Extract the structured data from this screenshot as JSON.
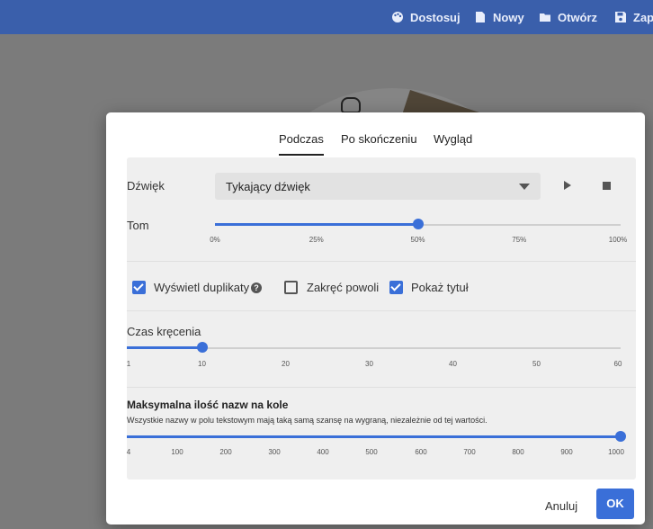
{
  "topbar": {
    "items": [
      {
        "label": "Dostosuj",
        "icon": "palette-icon"
      },
      {
        "label": "Nowy",
        "icon": "file-icon"
      },
      {
        "label": "Otwórz",
        "icon": "folder-icon"
      },
      {
        "label": "Zapi",
        "icon": "save-icon"
      }
    ]
  },
  "dialog": {
    "tabs": [
      {
        "label": "Podczas",
        "active": true
      },
      {
        "label": "Po skończeniu",
        "active": false
      },
      {
        "label": "Wygląd",
        "active": false
      }
    ],
    "sound": {
      "label": "Dźwięk",
      "value": "Tykający dźwięk"
    },
    "volume": {
      "label": "Tom",
      "value_percent": 50,
      "ticks": [
        "0%",
        "25%",
        "50%",
        "75%",
        "100%"
      ]
    },
    "checkboxes": [
      {
        "label": "Wyświetl duplikaty",
        "checked": true,
        "help": "?"
      },
      {
        "label": "Zakręć powoli",
        "checked": false
      },
      {
        "label": "Pokaż tytuł",
        "checked": true
      }
    ],
    "spin_time": {
      "label": "Czas kręcenia",
      "value": 10,
      "min": 1,
      "max": 60,
      "ticks": [
        "1",
        "10",
        "20",
        "30",
        "40",
        "50",
        "60"
      ]
    },
    "max_names": {
      "title": "Maksymalna ilość nazw na kole",
      "subtitle": "Wszystkie nazwy w polu tekstowym mają taką samą szansę na wygraną, niezależnie od tej wartości.",
      "value": 1000,
      "min": 4,
      "max": 1000,
      "ticks": [
        "4",
        "100",
        "200",
        "300",
        "400",
        "500",
        "600",
        "700",
        "800",
        "900",
        "1000"
      ]
    },
    "buttons": {
      "cancel": "Anuluj",
      "ok": "OK"
    }
  },
  "colors": {
    "topbar": "#3a5fab",
    "accent": "#3a6fd8",
    "panel": "#efefef"
  }
}
